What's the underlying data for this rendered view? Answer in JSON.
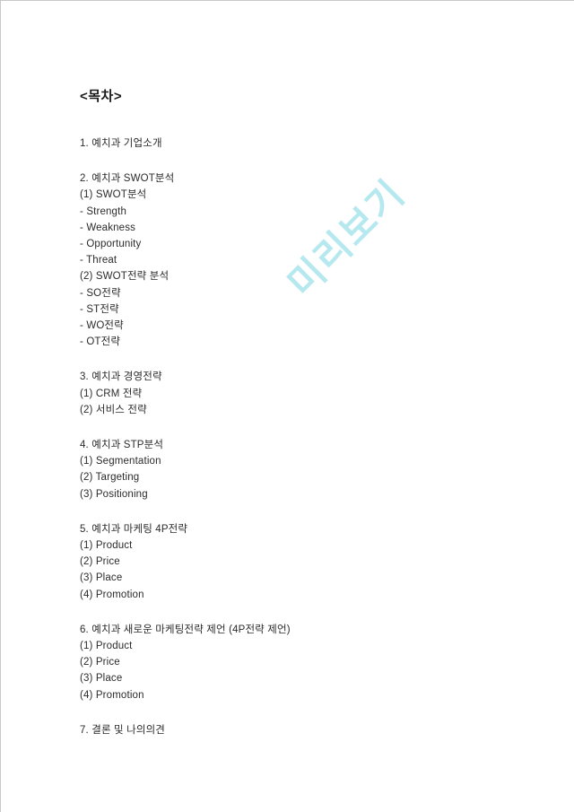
{
  "document": {
    "title": "<목차>",
    "watermark": "미리보기",
    "watermark_color": "#b6e9ef",
    "text_color": "#2b2b2b",
    "border_color": "#c8c8c8",
    "background": "#ffffff"
  },
  "toc": {
    "groups": [
      {
        "lines": [
          "1. 예치과 기업소개"
        ]
      },
      {
        "lines": [
          "2. 예치과 SWOT분석",
          "(1) SWOT분석",
          "- Strength",
          "- Weakness",
          "- Opportunity",
          "- Threat",
          "(2) SWOT전략 분석",
          "- SO전략",
          "- ST전략",
          "- WO전략",
          "- OT전략"
        ]
      },
      {
        "lines": [
          "3. 예치과 경영전략",
          "(1) CRM 전략",
          "(2) 서비스 전략"
        ]
      },
      {
        "lines": [
          "4. 예치과 STP분석",
          "(1) Segmentation",
          "(2) Targeting",
          "(3) Positioning"
        ]
      },
      {
        "lines": [
          "5. 예치과 마케팅 4P전략",
          "(1) Product",
          "(2) Price",
          "(3) Place",
          "(4) Promotion"
        ]
      },
      {
        "lines": [
          "6. 예치과 새로운 마케팅전략 제언 (4P전략 제언)",
          "(1) Product",
          "(2) Price",
          "(3) Place",
          "(4) Promotion"
        ]
      },
      {
        "lines": [
          "7. 결론 및 나의의견"
        ]
      }
    ]
  }
}
